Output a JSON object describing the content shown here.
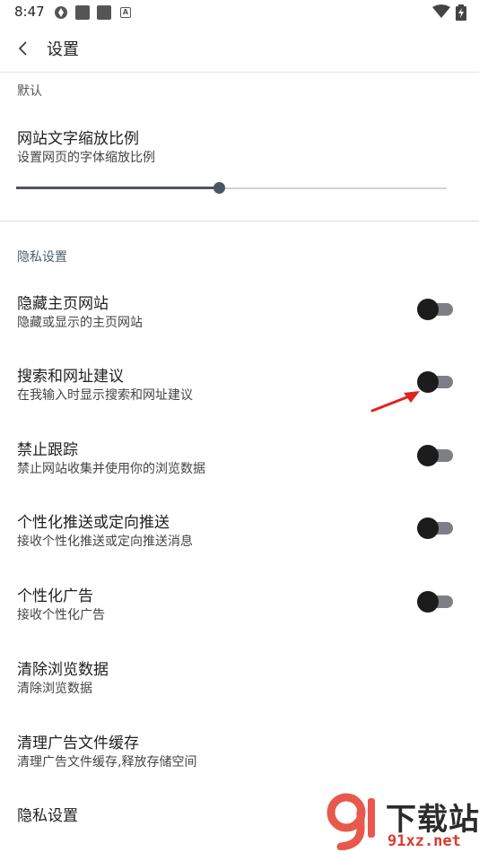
{
  "status_bar": {
    "time": "8:47",
    "icons": [
      "aperture-icon",
      "square-icon",
      "square-icon",
      "a-badge-icon",
      "wifi-icon",
      "battery-charging-icon"
    ]
  },
  "app_bar": {
    "back_icon": "chevron-left-icon",
    "title": "设置"
  },
  "default_section": {
    "label": "默认",
    "font_scale": {
      "title": "网站文字缩放比例",
      "subtitle": "设置网页的字体缩放比例",
      "slider_fraction": 0.47
    }
  },
  "privacy_section": {
    "label": "隐私设置",
    "items": [
      {
        "title": "隐藏主页网站",
        "subtitle": "隐藏或显示的主页网站",
        "has_toggle": true,
        "on": false
      },
      {
        "title": "搜索和网址建议",
        "subtitle": "在我输入时显示搜索和网址建议",
        "has_toggle": true,
        "on": false
      },
      {
        "title": "禁止跟踪",
        "subtitle": "禁止网站收集并使用你的浏览数据",
        "has_toggle": true,
        "on": false
      },
      {
        "title": "个性化推送或定向推送",
        "subtitle": "接收个性化推送或定向推送消息",
        "has_toggle": true,
        "on": false
      },
      {
        "title": "个性化广告",
        "subtitle": "接收个性化广告",
        "has_toggle": true,
        "on": false
      },
      {
        "title": "清除浏览数据",
        "subtitle": "清除浏览数据",
        "has_toggle": false
      },
      {
        "title": "清理广告文件缓存",
        "subtitle": "清理广告文件缓存,释放存储空间",
        "has_toggle": false
      },
      {
        "title": "隐私设置",
        "subtitle": "",
        "has_toggle": false
      }
    ]
  },
  "colors": {
    "accent": "#4a5666",
    "toggle_track": "#7c7f85",
    "toggle_thumb": "#1c1c1c",
    "annotation_arrow": "#e0231c"
  },
  "watermark": {
    "title": "下载站",
    "url": "91xz.net",
    "logo_icon": "9-logo-icon"
  }
}
